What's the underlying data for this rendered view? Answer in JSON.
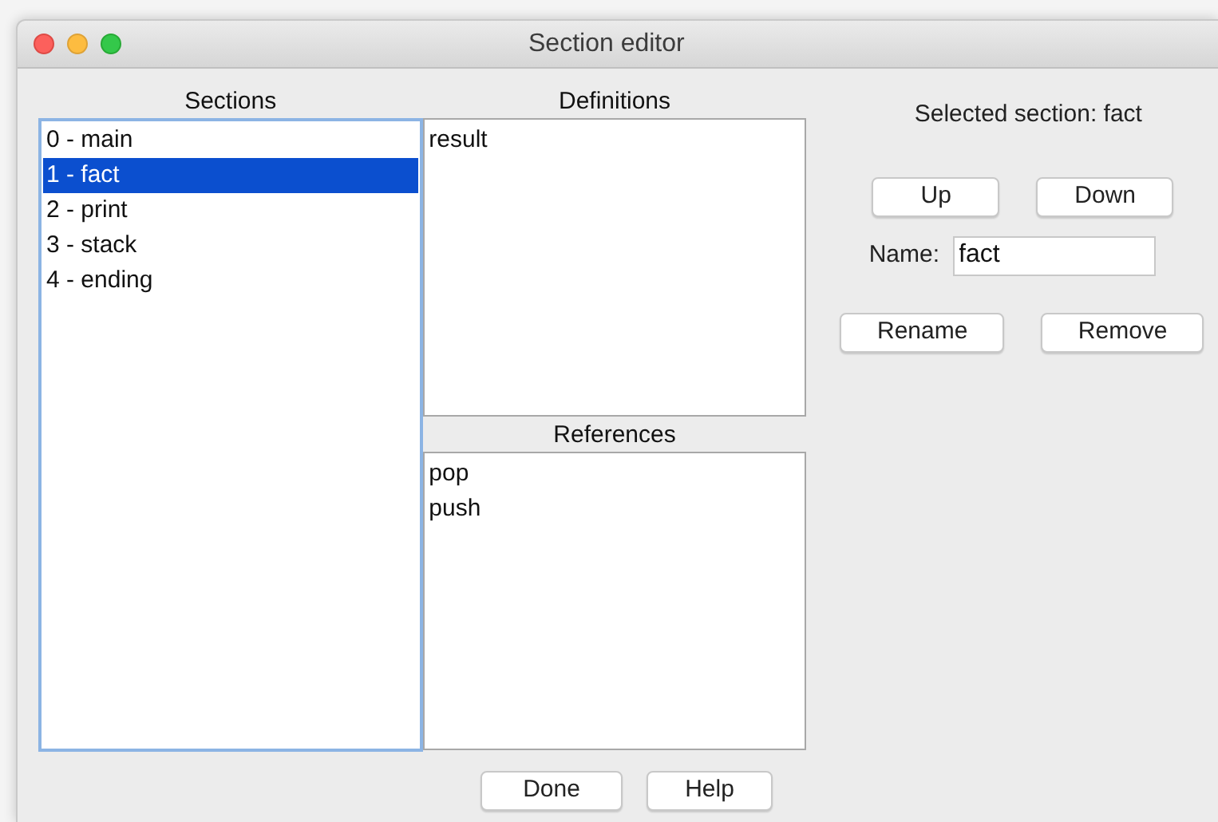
{
  "window": {
    "title": "Section editor"
  },
  "sections": {
    "label": "Sections",
    "items": [
      {
        "text": "0 - main",
        "selected": false
      },
      {
        "text": "1 - fact",
        "selected": true
      },
      {
        "text": "2 - print",
        "selected": false
      },
      {
        "text": "3 - stack",
        "selected": false
      },
      {
        "text": "4 - ending",
        "selected": false
      }
    ]
  },
  "definitions": {
    "label": "Definitions",
    "items": [
      "result"
    ]
  },
  "references": {
    "label": "References",
    "items": [
      "pop",
      "push"
    ]
  },
  "selected_section": "Selected section: fact",
  "move_buttons": [
    "Up",
    "Down"
  ],
  "name_field": {
    "label": "Name:",
    "value": "fact"
  },
  "edit_buttons": [
    "Rename",
    "Remove"
  ],
  "footer_buttons": [
    "Done",
    "Help"
  ]
}
